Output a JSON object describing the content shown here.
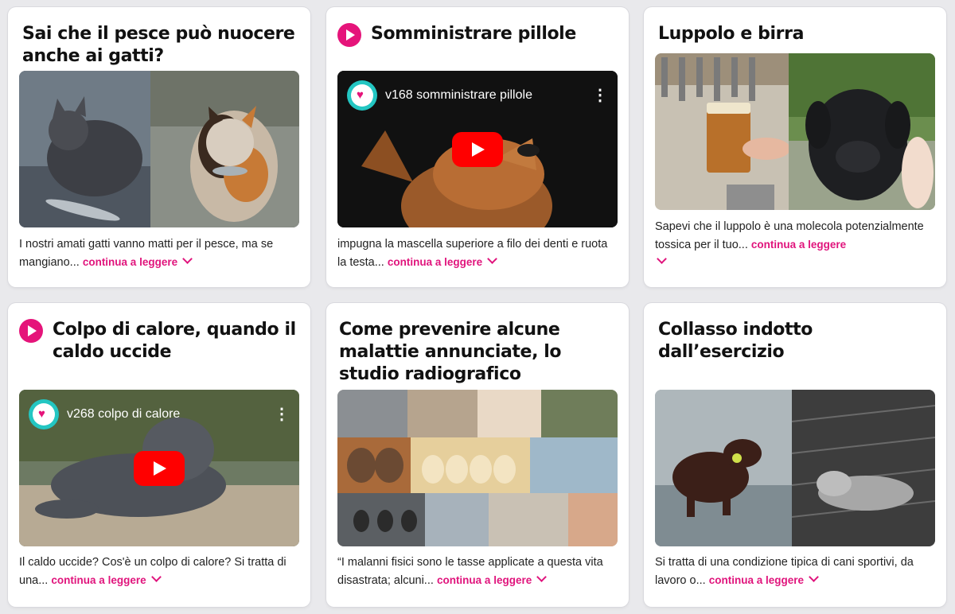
{
  "colors": {
    "accent": "#e0147c",
    "youtube_red": "#ff0000",
    "logo_teal": "#23c6c2"
  },
  "cards": [
    {
      "title": "Sai che il pesce può nuocere anche ai gatti?",
      "excerpt": "I nostri amati gatti vanno matti per il pesce, ma se mangiano...",
      "more": "continua a leggere",
      "media_type": "photo"
    },
    {
      "title": "Somministrare pillole",
      "video_title": "v168 somministrare pillole",
      "excerpt": "impugna la mascella superiore a filo dei denti e ruota la testa...",
      "more": "continua a leggere",
      "media_type": "video"
    },
    {
      "title": "Luppolo e birra",
      "excerpt": "Sapevi che il luppolo è una molecola potenzialmente tossica per il tuo...",
      "more": "continua a leggere",
      "media_type": "photo"
    },
    {
      "title": "Colpo di calore, quando il caldo uccide",
      "video_title": "v268 colpo di calore",
      "excerpt": "Il caldo uccide? Cos'è un colpo di calore? Si tratta di una...",
      "more": "continua a leggere",
      "media_type": "video"
    },
    {
      "title": "Come prevenire alcune malattie annunciate, lo studio radiografico",
      "excerpt": "“I malanni fisici sono le tasse applicate a questa vita disastrata; alcuni...",
      "more": "continua a leggere",
      "media_type": "photo"
    },
    {
      "title": "Collasso indotto dall’esercizio",
      "excerpt": "Si tratta di una condizione tipica di cani sportivi, da lavoro o...",
      "more": "continua a leggere",
      "media_type": "photo"
    }
  ]
}
